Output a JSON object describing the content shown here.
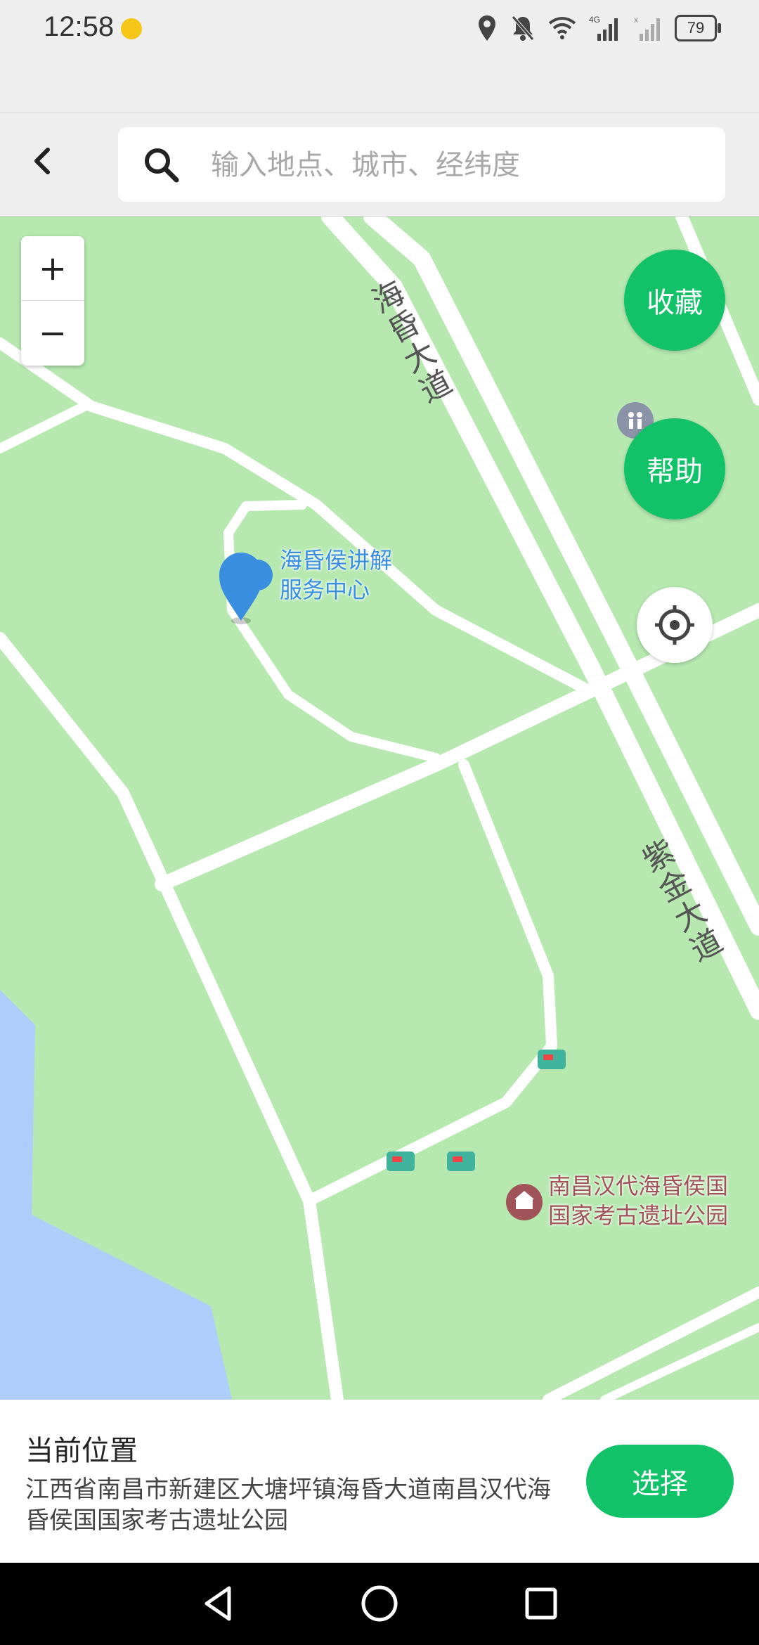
{
  "status_bar": {
    "time": "12:58",
    "battery": "79"
  },
  "search": {
    "placeholder": "输入地点、城市、经纬度",
    "value": ""
  },
  "map": {
    "zoom_in": "+",
    "zoom_out": "−",
    "roads": [
      "海昏大道",
      "紫金大道"
    ],
    "pois": [
      {
        "name": "海昏侯讲解\n服务中心",
        "color": "#3a8ee0"
      },
      {
        "name": "南昌汉代海昏侯国\n国家考古遗址公园",
        "color": "#a0545a"
      }
    ],
    "colors": {
      "land": "#b6e8b0",
      "road": "#ffffff",
      "water": "#aecdfa",
      "accent": "#11c268"
    }
  },
  "actions": {
    "favorite": "收藏",
    "help": "帮助"
  },
  "panel": {
    "title": "当前位置",
    "address": "江西省南昌市新建区大塘坪镇海昏大道南昌汉代海昏侯国国家考古遗址公园",
    "select": "选择"
  }
}
